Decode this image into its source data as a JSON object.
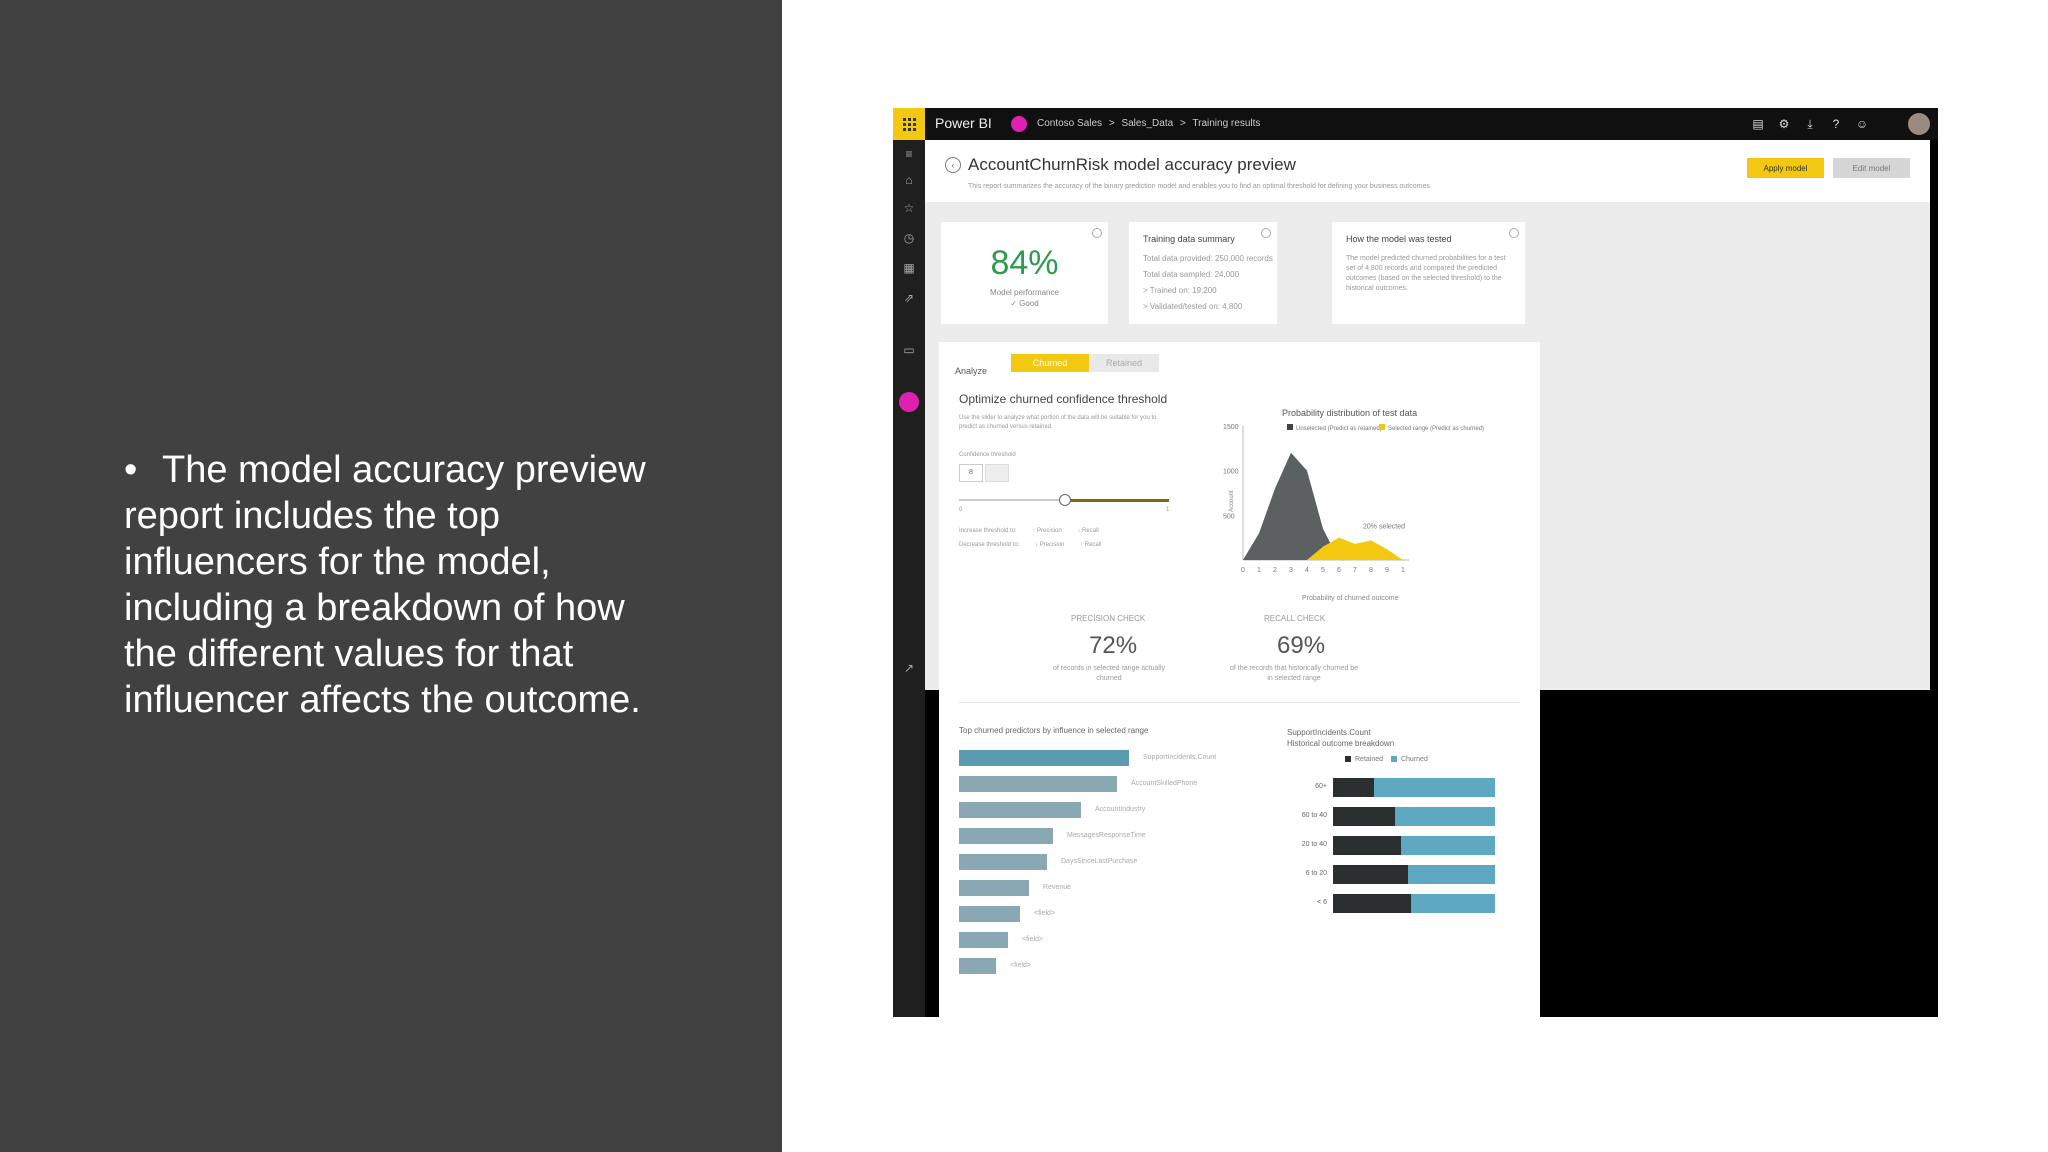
{
  "slide": {
    "bullet": "The model accuracy preview report includes the top influencers for the model, including a breakdown of how the different values for that influencer affects the outcome."
  },
  "app": {
    "brand": "Power BI",
    "breadcrumb": [
      "Contoso Sales",
      ">",
      "Sales_Data",
      ">",
      "Training results"
    ],
    "colors": {
      "accent": "#f2c811",
      "workspace": "#e020b0",
      "good": "#2e9a50",
      "retained": "#2b2f2f",
      "churned": "#5ea9c1",
      "predictor": "#8aa8b3",
      "distribution": "#5b6060"
    },
    "top_icons": [
      "chat-icon",
      "gear-icon",
      "download-icon",
      "help-icon",
      "smiley-icon"
    ],
    "nav_icons": [
      "menu-icon",
      "home-icon",
      "star-icon",
      "clock-icon",
      "apps-icon",
      "share-icon",
      "workspace-icon",
      "expand-icon"
    ]
  },
  "report": {
    "title": "AccountChurnRisk model accuracy preview",
    "subtitle": "This report summarizes the accuracy of the binary prediction model and enables you to find an optimal threshold for defining your business outcomes.",
    "apply_label": "Apply model",
    "edit_label": "Edit model"
  },
  "cards": {
    "performance": {
      "value": "84%",
      "label": "Model performance",
      "rating": "✓ Good"
    },
    "training": {
      "title": "Training data summary",
      "lines": [
        "Total data provided: 250,000 records",
        "Total data sampled: 24,000",
        "> Trained on: 19,200",
        "> Validated/tested on: 4,800"
      ]
    },
    "tested": {
      "title": "How the model was tested",
      "text": "The model predicted churned probabilities for a test set of 4,800 records and compared the predicted outcomes (based on the selected threshold) to the historical outcomes."
    }
  },
  "analyze": {
    "label": "Analyze",
    "tabs": [
      "Churned",
      "Retained"
    ],
    "title": "Optimize churned confidence threshold",
    "desc": "Use the slider to analyze what portion of the data will be suitable for you to predict as churned versus retained.",
    "threshold_label": "Confidence threshold",
    "threshold_value": "8",
    "threshold_level": 0.5,
    "slider_min": "0",
    "slider_max": "1",
    "increase_line": [
      "Increase threshold to:",
      "↑ Precision",
      "↓ Recall"
    ],
    "decrease_line": [
      "Decrease threshold to:",
      "↓ Precision",
      "↑ Recall"
    ],
    "precision": {
      "title": "PRECISION CHECK",
      "value": "72%",
      "desc": "of records in selected range actually churned"
    },
    "recall": {
      "title": "RECALL CHECK",
      "value": "69%",
      "desc": "of the records that historically churned be in selected range"
    }
  },
  "chart_data": [
    {
      "type": "area",
      "title": "Probability distribution of test data",
      "xlabel": "Probability of churned outcome",
      "ylabel": "Account",
      "x": [
        0,
        0.1,
        0.2,
        0.3,
        0.4,
        0.5,
        0.6,
        0.7,
        0.8,
        0.9,
        1.0
      ],
      "x_ticks": [
        "0",
        "1",
        "2",
        "3",
        "4",
        "5",
        "6",
        "7",
        "8",
        "9",
        "1"
      ],
      "y_ticks": [
        "500",
        "1000",
        "1500"
      ],
      "ylim": [
        0,
        1500
      ],
      "series": [
        {
          "name": "Unselected (Predict as retained)",
          "color": "#5b6060",
          "values": [
            0,
            300,
            800,
            1200,
            1000,
            350,
            0,
            0,
            0,
            0,
            0
          ]
        },
        {
          "name": "Selected range (Predict as churned)",
          "color": "#f2c811",
          "values": [
            0,
            0,
            0,
            0,
            0,
            150,
            250,
            180,
            220,
            120,
            0
          ]
        }
      ],
      "annotation": "20% selected",
      "legend": "top"
    },
    {
      "type": "bar",
      "title": "Top churned predictors by influence in selected range",
      "categories": [
        "SupportIncidents.Count",
        "AccountSkilledPhone",
        "AccountIndustry",
        "MessagesResponseTime",
        "DaysSinceLastPurchase",
        "Revenue",
        "<field>",
        "<field>",
        "<field>"
      ],
      "values": [
        100,
        93,
        72,
        55,
        52,
        41,
        36,
        29,
        22
      ]
    },
    {
      "type": "bar",
      "title": "SupportIncidents.Count",
      "subtitle": "Historical outcome breakdown",
      "categories": [
        "60+",
        "60 to 40",
        "20 to 40",
        "6 to 20",
        "< 6"
      ],
      "series": [
        {
          "name": "Retained",
          "values": [
            25,
            38,
            42,
            46,
            48
          ]
        },
        {
          "name": "Churned",
          "values": [
            75,
            62,
            58,
            54,
            52
          ]
        }
      ],
      "legend": "top"
    }
  ]
}
